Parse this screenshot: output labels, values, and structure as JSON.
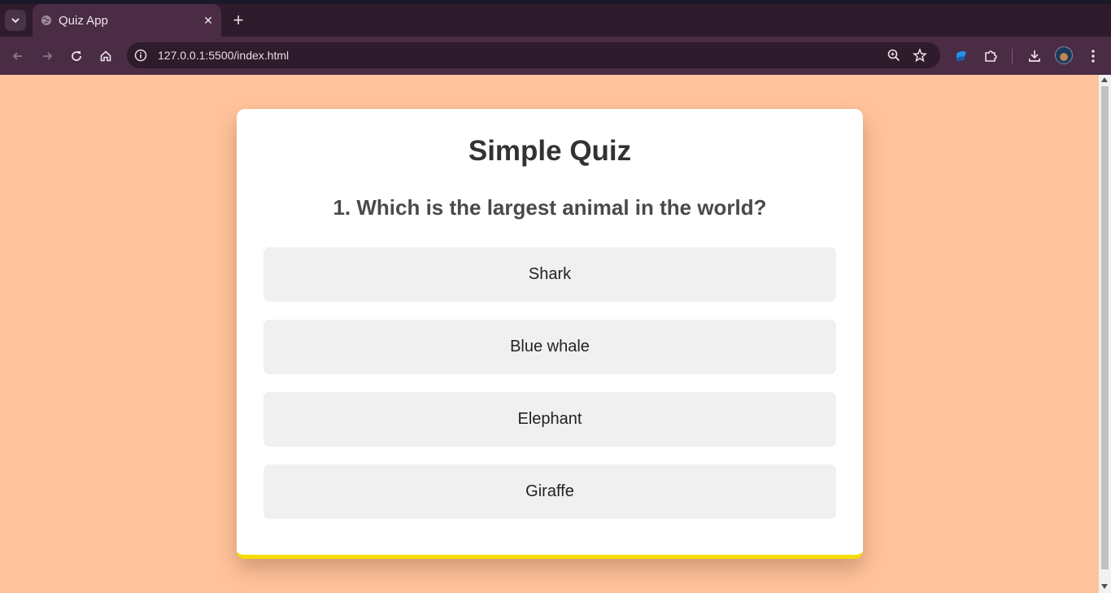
{
  "browser": {
    "tab_title": "Quiz App",
    "url": "127.0.0.1:5500/index.html",
    "colors": {
      "tabbar": "#2e1b2c",
      "toolbar": "#4a2c45"
    }
  },
  "quiz": {
    "title": "Simple Quiz",
    "question": "1. Which is the largest animal in the world?",
    "answers": [
      "Shark",
      "Blue whale",
      "Elephant",
      "Giraffe"
    ]
  },
  "colors": {
    "background": "#ffc39c",
    "card": "#ffffff",
    "accent": "#f5dd00",
    "answer_bg": "#f0f0f0"
  }
}
